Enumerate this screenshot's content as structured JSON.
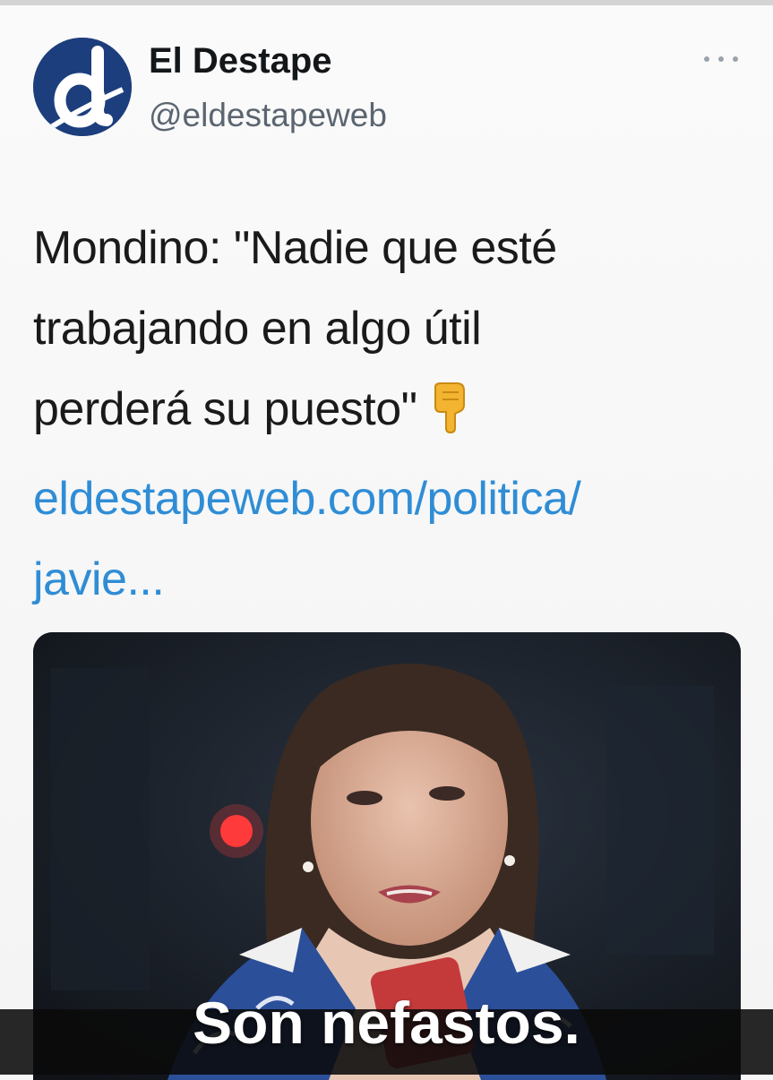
{
  "author": {
    "name": "El Destape",
    "handle": "@eldestapeweb",
    "avatar_icon": "el-destape-logo",
    "avatar_color": "#1d3e7d"
  },
  "tweet": {
    "text_lines": [
      "Mondino: \"Nadie que esté",
      "trabajando en algo útil",
      "perderá su puesto\""
    ],
    "emoji": "backhand-index-pointing-down",
    "link_lines": [
      "eldestapeweb.com/politica/",
      "javie..."
    ],
    "link_color": "#2f8dd6"
  },
  "media": {
    "description": "photo-woman-speaking"
  },
  "caption": {
    "text": "Son nefastos."
  },
  "icons": {
    "more": "more-dots-icon"
  }
}
